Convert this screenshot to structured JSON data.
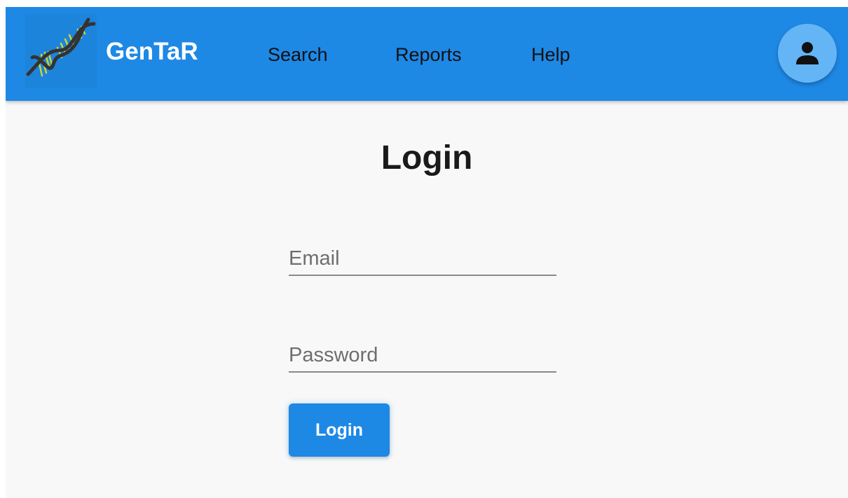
{
  "navbar": {
    "brand": "GenTaR",
    "logo_icon": "dna-helix-icon",
    "links": [
      {
        "label": "Search"
      },
      {
        "label": "Reports"
      },
      {
        "label": "Help"
      }
    ],
    "account_icon": "user-icon"
  },
  "login": {
    "title": "Login",
    "email_placeholder": "Email",
    "email_value": "",
    "password_placeholder": "Password",
    "password_value": "",
    "submit_label": "Login"
  },
  "colors": {
    "primary": "#1e88e5",
    "avatar": "#64b5f6",
    "background": "#f8f8f8",
    "helix_strand": "#333333",
    "helix_rungs": "#c8d43a"
  }
}
